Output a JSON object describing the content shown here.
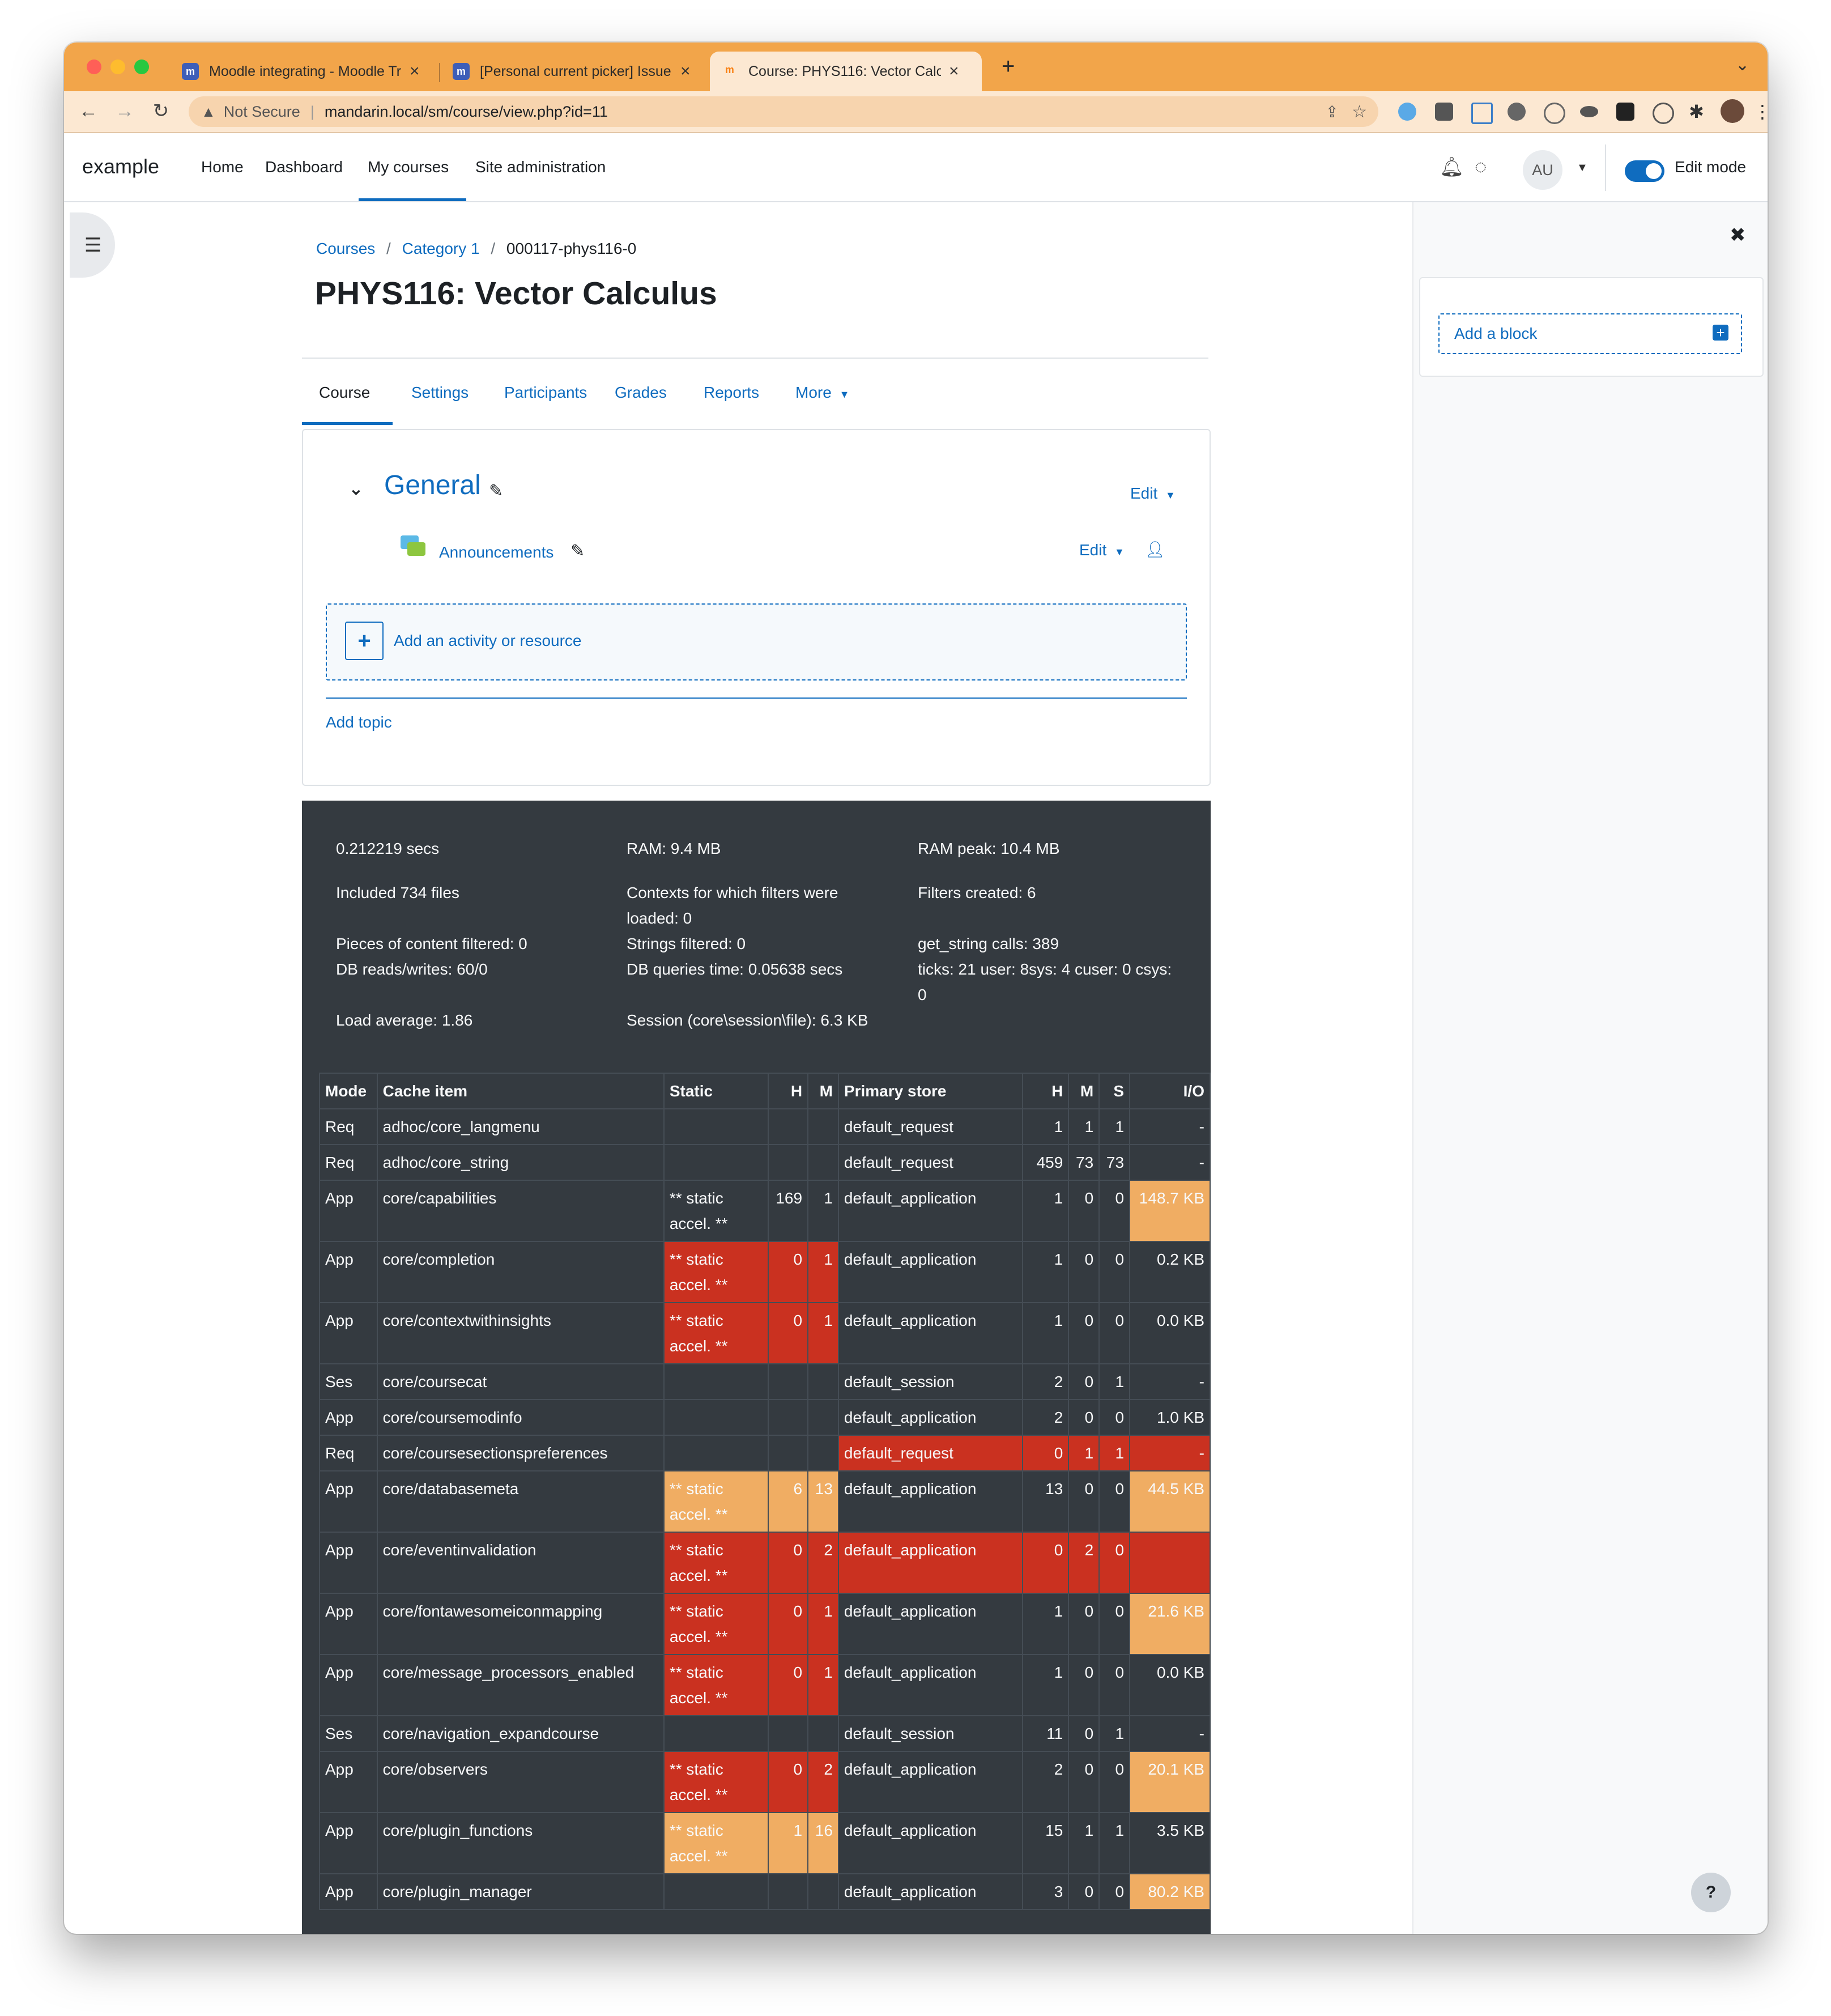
{
  "browser": {
    "tabs": [
      {
        "title": "Moodle integrating - Moodle Tr",
        "favicon_color": "#3e5eb8"
      },
      {
        "title": "[Personal current picker] Issue",
        "favicon_color": "#3e5eb8"
      },
      {
        "title": "Course: PHYS116: Vector Calcu",
        "favicon_color": "#f98012"
      }
    ],
    "new_tab": "+",
    "security_label": "Not Secure",
    "url": "mandarin.local/sm/course/view.php?id=11",
    "accent": "#f2a54a"
  },
  "nav": {
    "brand": "example",
    "links": [
      "Home",
      "Dashboard",
      "My courses",
      "Site administration"
    ],
    "avatar": "AU",
    "edit_mode": "Edit mode"
  },
  "breadcrumb": {
    "items": [
      "Courses",
      "Category 1"
    ],
    "current": "000117-phys116-0"
  },
  "page_title": "PHYS116: Vector Calculus",
  "course_tabs": [
    "Course",
    "Settings",
    "Participants",
    "Grades",
    "Reports",
    "More"
  ],
  "section": {
    "name": "General",
    "edit": "Edit",
    "activity": "Announcements",
    "add_activity": "Add an activity or resource",
    "add_topic": "Add topic"
  },
  "block_drawer": {
    "add_block": "Add a block"
  },
  "perf": {
    "stats": [
      "0.212219 secs",
      "RAM: 9.4 MB",
      "RAM peak: 10.4 MB",
      "Included 734 files",
      "Contexts for which filters were loaded: 0",
      "Filters created: 6",
      "Pieces of content filtered: 0",
      "Strings filtered: 0",
      "get_string calls: 389",
      "DB reads/writes: 60/0",
      "DB queries time: 0.05638 secs",
      "ticks: 21 user: 8sys: 4 cuser: 0 csys: 0",
      "Load average: 1.86",
      "Session (core\\session\\file): 6.3 KB"
    ],
    "headers": [
      "Mode",
      "Cache item",
      "Static",
      "H",
      "M",
      "Primary store",
      "H",
      "M",
      "S",
      "I/O"
    ],
    "rows": [
      [
        "Req",
        "adhoc/core_langmenu",
        "",
        "",
        "",
        "default_request",
        "1",
        "1",
        "1",
        "-"
      ],
      [
        "Req",
        "adhoc/core_string",
        "",
        "",
        "",
        "default_request",
        "459",
        "73",
        "73",
        "-"
      ],
      [
        "App",
        "core/capabilities",
        "** static accel. **",
        "169",
        "1",
        "default_application",
        "1",
        "0",
        "0",
        "148.7 KB"
      ],
      [
        "App",
        "core/completion",
        "** static accel. **",
        "0",
        "1",
        "default_application",
        "1",
        "0",
        "0",
        "0.2 KB"
      ],
      [
        "App",
        "core/contextwithinsights",
        "** static accel. **",
        "0",
        "1",
        "default_application",
        "1",
        "0",
        "0",
        "0.0 KB"
      ],
      [
        "Ses",
        "core/coursecat",
        "",
        "",
        "",
        "default_session",
        "2",
        "0",
        "1",
        "-"
      ],
      [
        "App",
        "core/coursemodinfo",
        "",
        "",
        "",
        "default_application",
        "2",
        "0",
        "0",
        "1.0 KB"
      ],
      [
        "Req",
        "core/coursesectionspreferences",
        "",
        "",
        "",
        "default_request",
        "0",
        "1",
        "1",
        "-"
      ],
      [
        "App",
        "core/databasemeta",
        "** static accel. **",
        "6",
        "13",
        "default_application",
        "13",
        "0",
        "0",
        "44.5 KB"
      ],
      [
        "App",
        "core/eventinvalidation",
        "** static accel. **",
        "0",
        "2",
        "default_application",
        "0",
        "2",
        "0",
        ""
      ],
      [
        "App",
        "core/fontawesomeiconmapping",
        "** static accel. **",
        "0",
        "1",
        "default_application",
        "1",
        "0",
        "0",
        "21.6 KB"
      ],
      [
        "App",
        "core/message_processors_enabled",
        "** static accel. **",
        "0",
        "1",
        "default_application",
        "1",
        "0",
        "0",
        "0.0 KB"
      ],
      [
        "Ses",
        "core/navigation_expandcourse",
        "",
        "",
        "",
        "default_session",
        "11",
        "0",
        "1",
        "-"
      ],
      [
        "App",
        "core/observers",
        "** static accel. **",
        "0",
        "2",
        "default_application",
        "2",
        "0",
        "0",
        "20.1 KB"
      ],
      [
        "App",
        "core/plugin_functions",
        "** static accel. **",
        "1",
        "16",
        "default_application",
        "15",
        "1",
        "1",
        "3.5 KB"
      ],
      [
        "App",
        "core/plugin_manager",
        "",
        "",
        "",
        "default_application",
        "3",
        "0",
        "0",
        "80.2 KB"
      ]
    ],
    "row_colors": [
      [
        "",
        "",
        "",
        "",
        "",
        "",
        "",
        "",
        "",
        ""
      ],
      [
        "",
        "",
        "",
        "",
        "",
        "",
        "",
        "",
        "",
        ""
      ],
      [
        "",
        "",
        "",
        "",
        "",
        "",
        "",
        "",
        "",
        "org"
      ],
      [
        "",
        "",
        "red",
        "red",
        "red",
        "",
        "",
        "",
        "",
        ""
      ],
      [
        "",
        "",
        "red",
        "red",
        "red",
        "",
        "",
        "",
        "",
        ""
      ],
      [
        "",
        "",
        "",
        "",
        "",
        "",
        "",
        "",
        "",
        ""
      ],
      [
        "",
        "",
        "",
        "",
        "",
        "",
        "",
        "",
        "",
        ""
      ],
      [
        "",
        "",
        "",
        "",
        "",
        "red",
        "red",
        "red",
        "red",
        "red"
      ],
      [
        "",
        "",
        "org",
        "org",
        "org",
        "",
        "",
        "",
        "",
        "org"
      ],
      [
        "",
        "",
        "red",
        "red",
        "red",
        "red",
        "red",
        "red",
        "red",
        "red"
      ],
      [
        "",
        "",
        "red",
        "red",
        "red",
        "",
        "",
        "",
        "",
        "org"
      ],
      [
        "",
        "",
        "red",
        "red",
        "red",
        "",
        "",
        "",
        "",
        ""
      ],
      [
        "",
        "",
        "",
        "",
        "",
        "",
        "",
        "",
        "",
        ""
      ],
      [
        "",
        "",
        "red",
        "red",
        "red",
        "",
        "",
        "",
        "",
        "org"
      ],
      [
        "",
        "",
        "org",
        "org",
        "org",
        "",
        "",
        "",
        "",
        ""
      ],
      [
        "",
        "",
        "",
        "",
        "",
        "",
        "",
        "",
        "",
        "org"
      ]
    ]
  },
  "help": "?"
}
